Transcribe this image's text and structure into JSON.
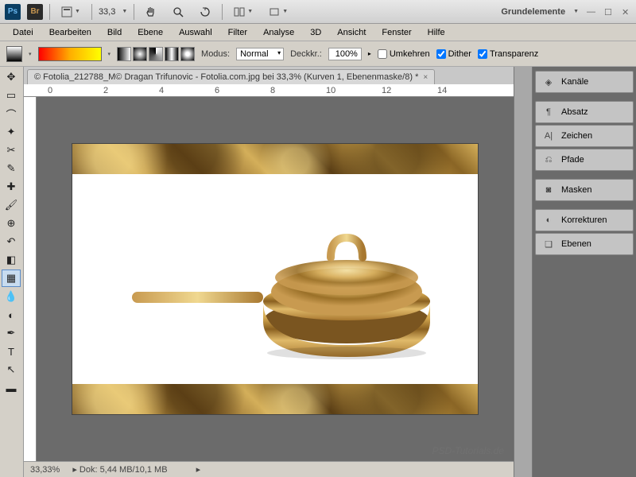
{
  "topbar": {
    "zoom": "33,3",
    "workspace": "Grundelemente"
  },
  "menu": [
    "Datei",
    "Bearbeiten",
    "Bild",
    "Ebene",
    "Auswahl",
    "Filter",
    "Analyse",
    "3D",
    "Ansicht",
    "Fenster",
    "Hilfe"
  ],
  "options": {
    "modus_label": "Modus:",
    "modus_value": "Normal",
    "deckkraft_label": "Deckkr.:",
    "deckkraft_value": "100%",
    "umkehren": "Umkehren",
    "dither": "Dither",
    "transparenz": "Transparenz"
  },
  "tab": {
    "title": "© Fotolia_212788_M© Dragan Trifunovic - Fotolia.com.jpg bei 33,3% (Kurven 1, Ebenenmaske/8) *"
  },
  "ruler_marks": [
    "0",
    "2",
    "4",
    "6",
    "8",
    "10",
    "12",
    "14"
  ],
  "status": {
    "zoom": "33,33%",
    "doc": "Dok: 5,44 MB/10,1 MB"
  },
  "panels": [
    "Kanäle",
    "Absatz",
    "Zeichen",
    "Pfade",
    "Masken",
    "Korrekturen",
    "Ebenen"
  ],
  "watermark": "PSD-Tutorials.de"
}
